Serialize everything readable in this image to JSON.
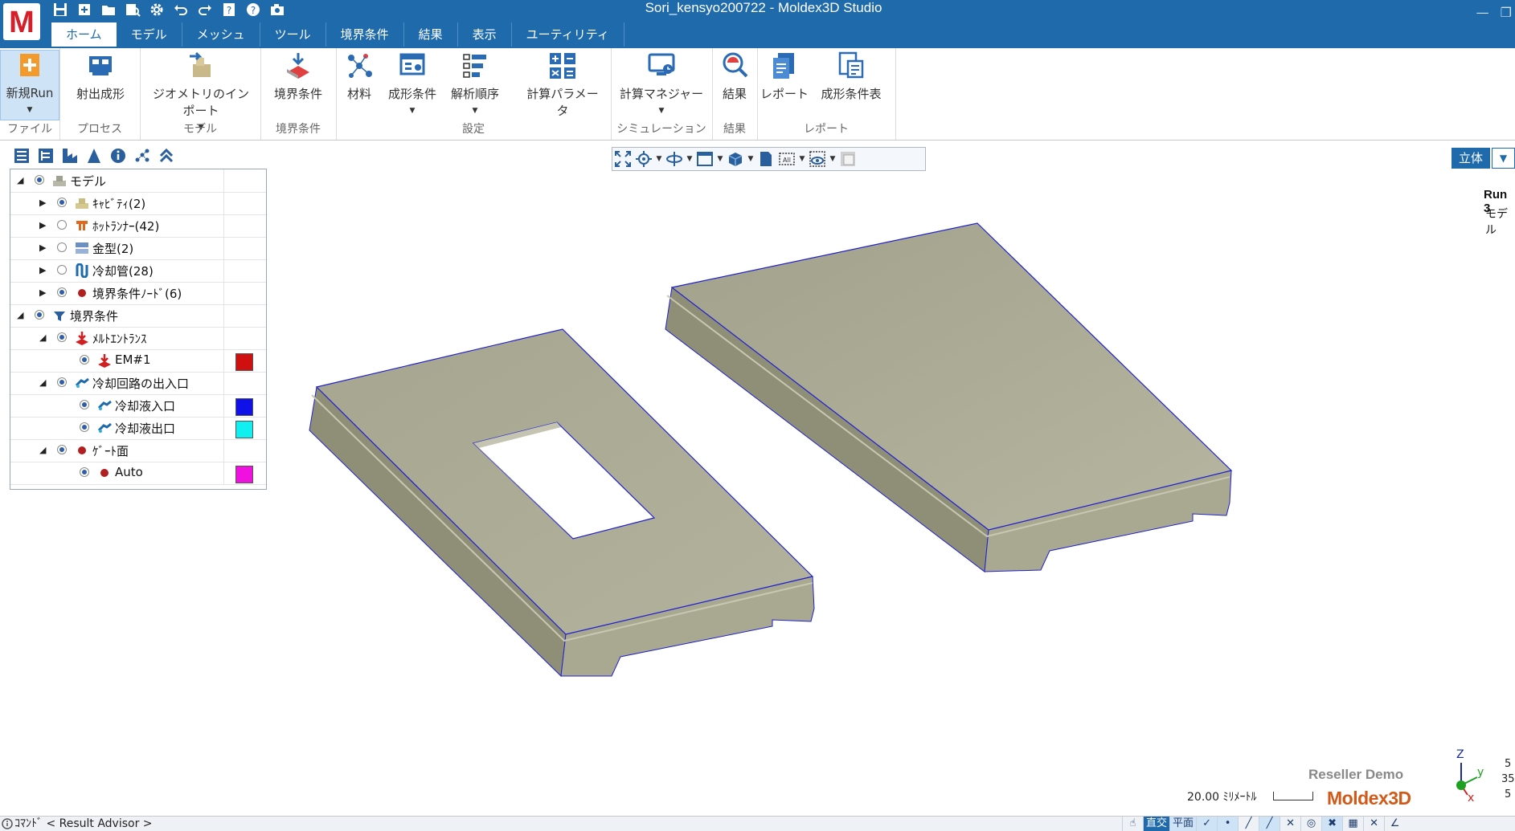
{
  "window": {
    "title": "Sori_kensyo200722 - Moldex3D Studio",
    "logo": "M",
    "controls": [
      "minimize-icon",
      "restore-icon"
    ]
  },
  "quick_access": [
    "save-icon",
    "new-icon",
    "open-folder-icon",
    "find-icon",
    "settings-gear-icon",
    "undo-icon",
    "redo-icon",
    "help-book-icon",
    "help-icon",
    "camera-icon"
  ],
  "tabs": [
    {
      "label": "ホーム",
      "active": true
    },
    {
      "label": "モデル"
    },
    {
      "label": "メッシュ"
    },
    {
      "label": "ツール"
    },
    {
      "label": "境界条件"
    },
    {
      "label": "結果"
    },
    {
      "label": "表示"
    },
    {
      "label": "ユーティリティ"
    }
  ],
  "ribbon": {
    "file": {
      "group": "ファイル",
      "new_run": "新規Run"
    },
    "process": {
      "group": "プロセス",
      "injection": "射出成形"
    },
    "model": {
      "group": "モデル",
      "import": "ジオメトリのインポート"
    },
    "bc": {
      "group": "境界条件",
      "bc": "境界条件"
    },
    "settings": {
      "group": "設定",
      "material": "材料",
      "molding": "成形条件",
      "sequence": "解析順序",
      "params": "計算パラメータ"
    },
    "simulation": {
      "group": "シミュレーション",
      "manager": "計算マネジャー"
    },
    "results": {
      "group": "結果",
      "results": "結果"
    },
    "report": {
      "group": "レポート",
      "report": "レポート",
      "table": "成形条件表"
    }
  },
  "tree": {
    "rows": [
      {
        "label": "モデル",
        "icon": "model-icon",
        "expand": "expanded",
        "radio": "on"
      },
      {
        "label": "ｷｬﾋﾞﾃｨ(2)",
        "icon": "cavity-icon",
        "expand": "collapsed",
        "radio": "on"
      },
      {
        "label": "ﾎｯﾄﾗﾝﾅｰ(42)",
        "icon": "hot-runner-icon",
        "expand": "collapsed",
        "radio": "off"
      },
      {
        "label": "金型(2)",
        "icon": "mold-icon",
        "expand": "collapsed",
        "radio": "off"
      },
      {
        "label": "冷却管(28)",
        "icon": "cooling-channel-icon",
        "expand": "collapsed",
        "radio": "off"
      },
      {
        "label": "境界条件ﾉｰﾄﾞ(6)",
        "icon": "bc-node-icon",
        "expand": "collapsed",
        "radio": "on"
      },
      {
        "label": "境界条件",
        "icon": "boundary-condition-icon",
        "expand": "expanded",
        "radio": "on"
      },
      {
        "label": "ﾒﾙﾄｴﾝﾄﾗﾝｽ",
        "icon": "melt-entrance-icon",
        "expand": "expanded",
        "radio": "on"
      },
      {
        "label": "EM#1",
        "icon": "melt-entrance-icon",
        "radio": "on",
        "color": "#d01010"
      },
      {
        "label": "冷却回路の出入口",
        "icon": "coolant-io-icon",
        "expand": "expanded",
        "radio": "on"
      },
      {
        "label": "冷却液入口",
        "icon": "coolant-io-icon",
        "radio": "on",
        "color": "#1010e8"
      },
      {
        "label": "冷却液出口",
        "icon": "coolant-io-icon",
        "radio": "on",
        "color": "#10f0f0"
      },
      {
        "label": "ｹﾞｰﾄ面",
        "icon": "gate-surface-icon",
        "expand": "expanded",
        "radio": "on"
      },
      {
        "label": "Auto",
        "icon": "gate-surface-icon",
        "radio": "on",
        "color": "#f010e0"
      }
    ]
  },
  "viewport": {
    "projection": "立体",
    "run_label": "Run 3",
    "model_label": "モデル",
    "reseller": "Reseller Demo",
    "brand": "Moldex3D",
    "scale_text": "20.00 ﾐﾘﾒｰﾄﾙ",
    "triad_values": [
      "5",
      "35",
      "5"
    ]
  },
  "statusbar": {
    "command": "ｺﾏﾝﾄﾞ < Result Advisor >",
    "tools": [
      "直交",
      "平面"
    ]
  },
  "colors": {
    "accent": "#1e6aab",
    "part_fill": "#a8a890",
    "part_edge": "#2020d0"
  }
}
